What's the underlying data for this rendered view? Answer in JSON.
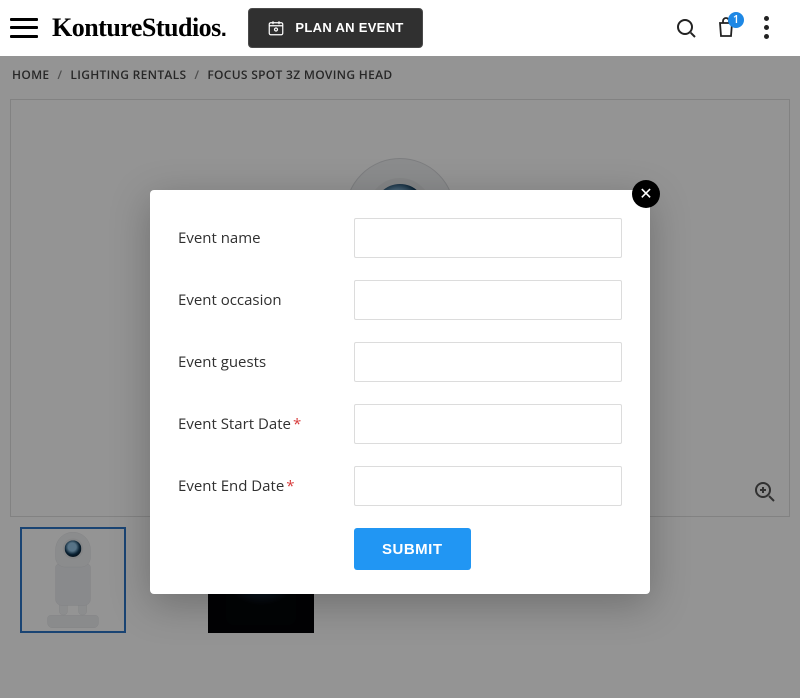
{
  "header": {
    "logo": "KontureStudios",
    "plan_label": "PLAN AN EVENT",
    "cart_count": "1"
  },
  "breadcrumb": {
    "items": [
      "HOME",
      "LIGHTING RENTALS",
      "FOCUS SPOT 3Z MOVING HEAD"
    ]
  },
  "modal": {
    "fields": {
      "name": {
        "label": "Event name",
        "required": false
      },
      "occasion": {
        "label": "Event occasion",
        "required": false
      },
      "guests": {
        "label": "Event guests",
        "required": false
      },
      "start": {
        "label": "Event Start Date",
        "required": true
      },
      "end": {
        "label": "Event End Date",
        "required": true
      }
    },
    "submit_label": "SUBMIT",
    "required_marker": "*"
  }
}
